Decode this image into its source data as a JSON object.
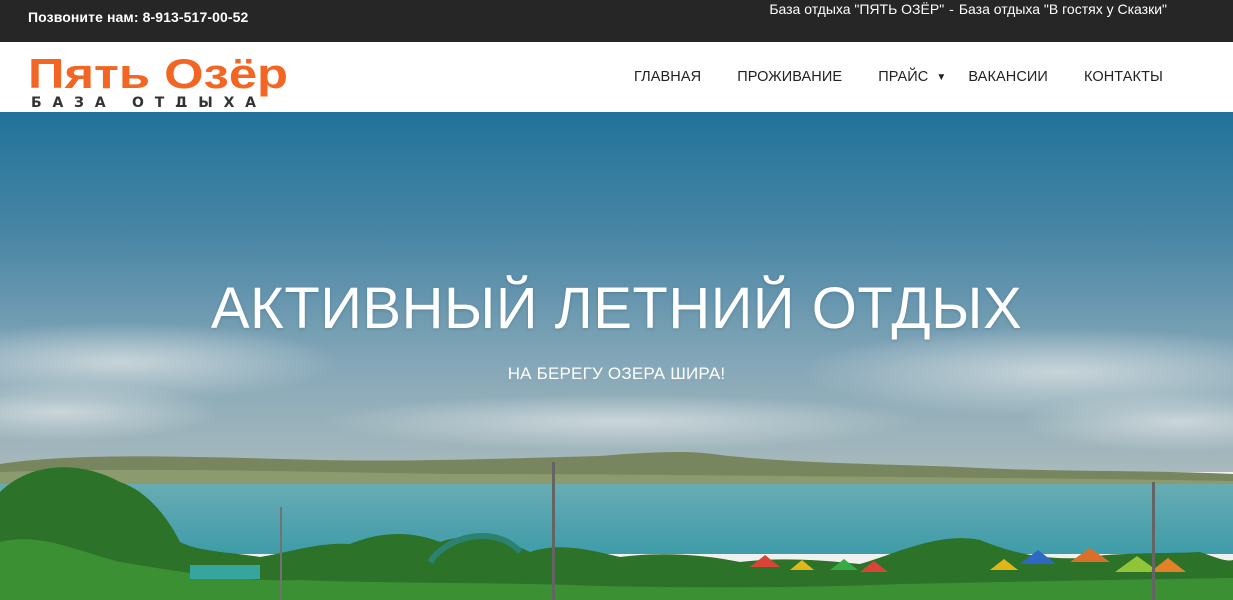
{
  "topbar": {
    "phone": "Позвоните нам: 8-913-517-00-52",
    "link1": "База отдыха \"ПЯТЬ ОЗЁР\"",
    "separator": "-",
    "link2": "База отдыха \"В гостях у Сказки\""
  },
  "logo": {
    "title": "Пять Озёр",
    "subtitle": "БАЗА ОТДЫХА",
    "color": "#f26522"
  },
  "nav": {
    "items": [
      {
        "label": "ГЛАВНАЯ"
      },
      {
        "label": "ПРОЖИВАНИЕ"
      },
      {
        "label": "ПРАЙС"
      },
      {
        "label": "ВАКАНСИИ"
      },
      {
        "label": "КОНТАКТЫ"
      }
    ]
  },
  "hero": {
    "title": "АКТИВНЫЙ ЛЕТНИЙ ОТДЫХ",
    "subtitle": "НА БЕРЕГУ ОЗЕРА ШИРА!"
  },
  "colors": {
    "topbar_bg": "#262626",
    "accent": "#f26522",
    "sky_top": "#2a7ea8",
    "lake": "#4fb2bd"
  }
}
